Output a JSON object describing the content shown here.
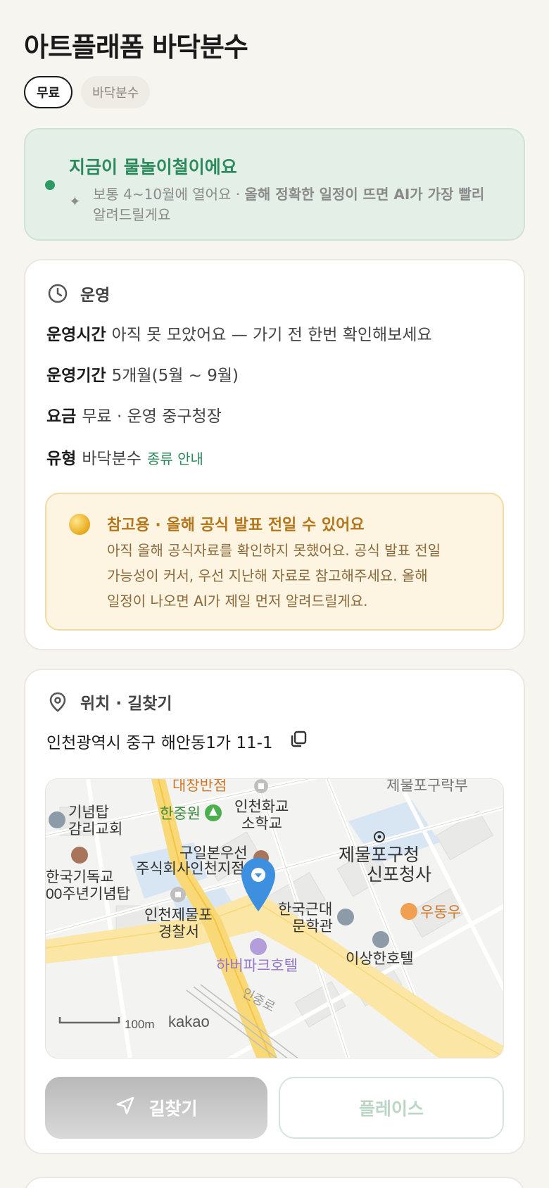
{
  "header": {
    "title": "아트플래폼 바닥분수"
  },
  "chips": [
    {
      "label": "무료",
      "active": true
    },
    {
      "label": "바닥분수",
      "active": false
    }
  ],
  "season": {
    "title": "지금이 물놀이철이에요",
    "desc_plain": "보통 4~10월에 열어요 · ",
    "desc_bold": "올해 정확한 일정이 뜨면 AI가 가장 빨리",
    "desc_tail": "알려드릴게요",
    "accent": "#2e9a66"
  },
  "operation": {
    "heading": "운영",
    "rows": [
      {
        "key": "운영시간",
        "value": "아직 못 모았어요 — 가기 전 한번 확인해보세요"
      },
      {
        "key": "운영기간",
        "value": "5개월(5월 ~ 9월)"
      },
      {
        "key": "요금",
        "value": "무료 · 운영 중구청장"
      },
      {
        "key": "유형",
        "value": "바닥분수",
        "link": "종류 안내"
      }
    ],
    "notice": {
      "title": "참고용 · 올해 공식 발표 전일 수 있어요",
      "body_1": "아직 올해 공식자료를 확인하지 못했어요. 공식 발표 전일",
      "body_2": "가능성이 커서, 우선 지난해 자료로 참고해주세요. 올해",
      "body_3": "일정이 나오면 AI가 제일 먼저 알려드릴게요."
    }
  },
  "location": {
    "heading": "위치 · 길찾기",
    "address": "인천광역시 중구 해안동1가 11-1",
    "map": {
      "labels": {
        "l1": "대창반점",
        "l2": "인천화교",
        "l3": "소학교",
        "l4": "제물포구락부",
        "l5": "기념탑",
        "l6": "감리교회",
        "l7": "한중원",
        "l8": "구일본우선",
        "l9": "주식회사인천지점",
        "l10": "제물포구청",
        "l11": "신포청사",
        "l12": "한국기독교",
        "l13": "00주년기념탑",
        "l14": "인천제물포",
        "l15": "경찰서",
        "l16": "한국근대",
        "l17": "문학관",
        "l18": "우동우",
        "l19": "이상한호텔",
        "l20": "하버파크호텔",
        "l21": "인중로"
      },
      "scale": "100m",
      "brand": "kakao"
    },
    "buttons": {
      "directions": "길찾기",
      "place": "플레이스"
    }
  }
}
